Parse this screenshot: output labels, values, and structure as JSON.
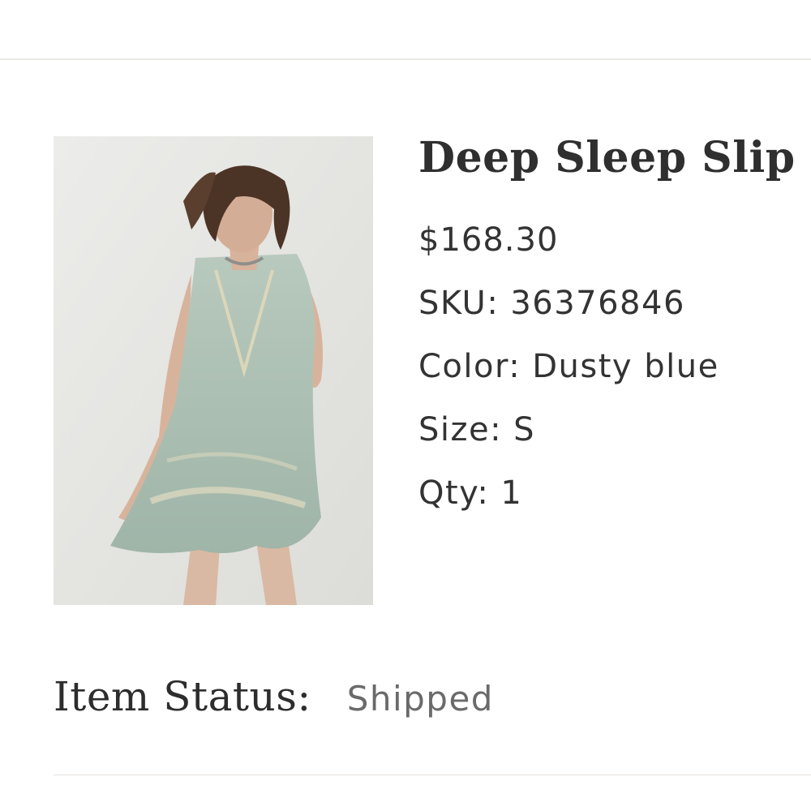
{
  "product": {
    "title": "Deep Sleep Slip",
    "price": "$168.30",
    "image_icon": "product-photo",
    "attributes": {
      "sku_label": "SKU:",
      "sku_value": "36376846",
      "color_label": "Color:",
      "color_value": "Dusty blue",
      "size_label": "Size:",
      "size_value": "S",
      "qty_label": "Qty:",
      "qty_value": "1"
    }
  },
  "status": {
    "label": "Item Status:",
    "value": "Shipped"
  },
  "colors": {
    "background": "#ffffff",
    "text": "#333333",
    "status_value": "#6a6a6a",
    "divider": "#eceae6",
    "dress": "#a9bfb2"
  }
}
